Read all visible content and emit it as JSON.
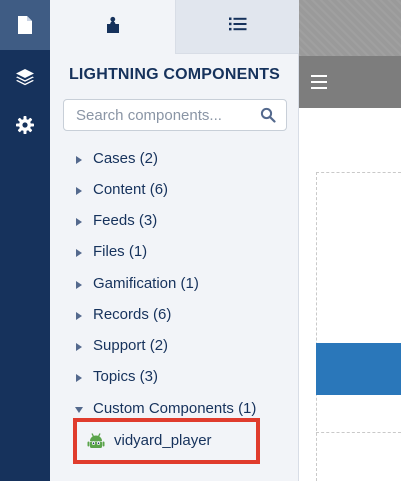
{
  "rail": {
    "items": [
      {
        "icon": "page-icon",
        "active": true
      },
      {
        "icon": "layers-icon",
        "active": false
      },
      {
        "icon": "gear-icon",
        "active": false
      }
    ]
  },
  "panel": {
    "tabs": [
      {
        "icon": "components-icon",
        "active": true
      },
      {
        "icon": "list-icon",
        "active": false
      }
    ],
    "title": "LIGHTNING COMPONENTS",
    "search": {
      "placeholder": "Search components..."
    },
    "tree": [
      {
        "label": "Cases (2)",
        "expanded": false
      },
      {
        "label": "Content (6)",
        "expanded": false
      },
      {
        "label": "Feeds (3)",
        "expanded": false
      },
      {
        "label": "Files (1)",
        "expanded": false
      },
      {
        "label": "Gamification (1)",
        "expanded": false
      },
      {
        "label": "Records (6)",
        "expanded": false
      },
      {
        "label": "Support (2)",
        "expanded": false
      },
      {
        "label": "Topics (3)",
        "expanded": false
      },
      {
        "label": "Custom Components (1)",
        "expanded": true
      }
    ],
    "custom_child": {
      "label": "vidyard_player",
      "icon": "android-robot-icon",
      "highlight_color": "#e03c2d"
    }
  },
  "colors": {
    "rail_bg": "#16325c",
    "rail_active": "#3f5c84",
    "panel_bg": "#f2f4f8",
    "text": "#16325c",
    "canvas_nav": "#7d7d7d",
    "canvas_block": "#2a77ba"
  }
}
